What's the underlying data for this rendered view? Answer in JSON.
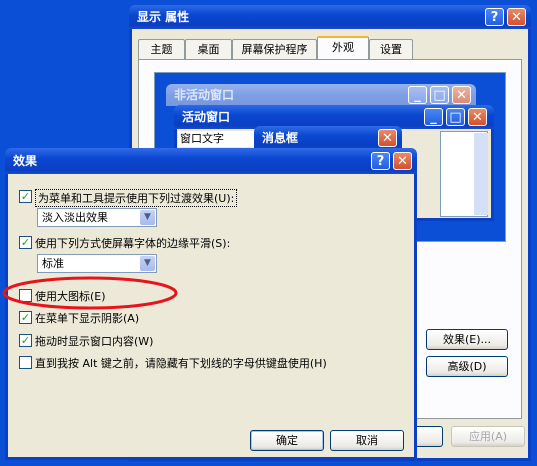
{
  "display_props": {
    "title": "显示 属性",
    "tabs": [
      "主题",
      "桌面",
      "屏幕保护程序",
      "外观",
      "设置"
    ],
    "active_tab_index": 3,
    "preview": {
      "inactive_title": "非活动窗口",
      "active_title": "活动窗口",
      "window_text": "窗口文字",
      "message_box_title": "消息框"
    },
    "effects_button": "效果(E)...",
    "advanced_button": "高级(D)",
    "apply_button": "应用(A)"
  },
  "effects_dialog": {
    "title": "效果",
    "help_button": "?",
    "close_button": "✕",
    "options": [
      {
        "label": "为菜单和工具提示使用下列过渡效果(U):",
        "checked": true
      },
      {
        "label": "使用下列方式使屏幕字体的边缘平滑(S):",
        "checked": true
      },
      {
        "label": "使用大图标(E)",
        "checked": false
      },
      {
        "label": "在菜单下显示阴影(A)",
        "checked": true
      },
      {
        "label": "拖动时显示窗口内容(W)",
        "checked": true
      },
      {
        "label": "直到我按 Alt 键之前，请隐藏有下划线的字母供键盘使用(H)",
        "checked": false
      }
    ],
    "transition_effect": "淡入淡出效果",
    "smoothing_method": "标准",
    "ok_button": "确定",
    "cancel_button": "取消"
  },
  "colors": {
    "desktop": "#0a4fd6",
    "dialog_bg": "#ece9d8",
    "highlight_ring": "#e8141c"
  }
}
